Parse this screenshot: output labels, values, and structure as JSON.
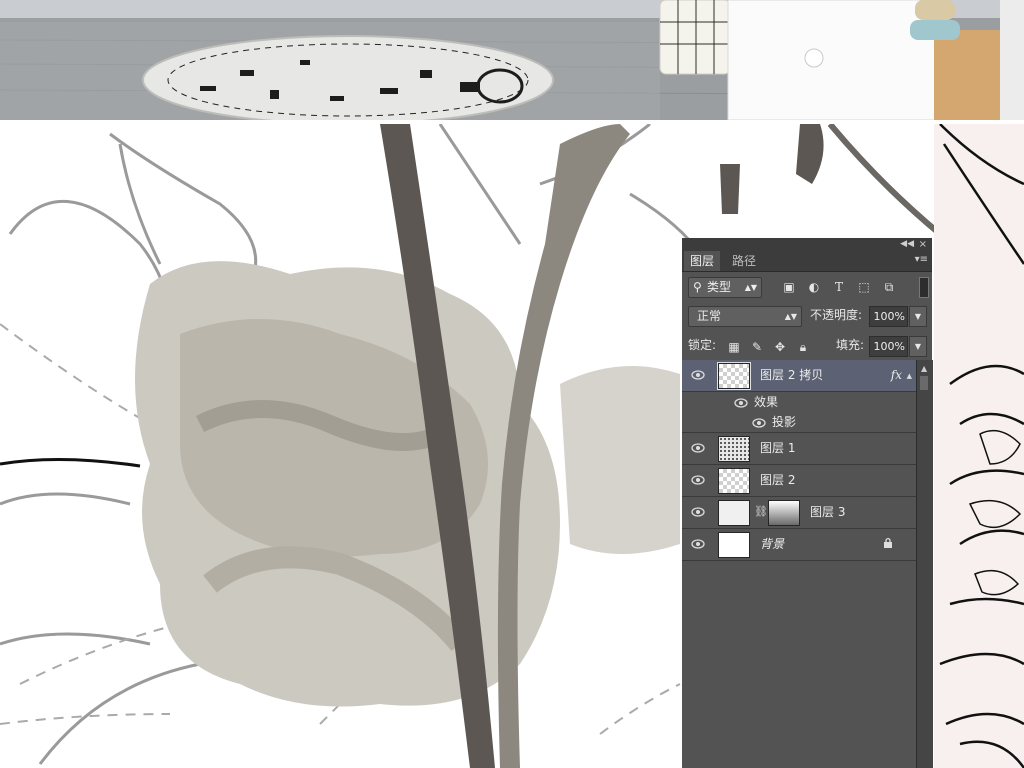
{
  "panel": {
    "collapse_icon": "double-arrow-icon",
    "close_label": "×",
    "tabs": [
      {
        "label": "图层"
      },
      {
        "label": "路径"
      }
    ],
    "menu_icon": "panel-menu-icon",
    "filter": {
      "kind_label": "类型",
      "icons": [
        "image-filter-icon",
        "adjustment-filter-icon",
        "type-filter-icon",
        "shape-filter-icon",
        "smartobject-filter-icon"
      ]
    },
    "blend_mode": "正常",
    "opacity_label": "不透明度:",
    "opacity_value": "100%",
    "lock_label": "锁定:",
    "lock_icons": [
      "lock-transparent-icon",
      "lock-image-icon",
      "lock-position-icon",
      "lock-all-icon"
    ],
    "fill_label": "填充:",
    "fill_value": "100%",
    "layers": [
      {
        "name": "图层 2 拷贝",
        "selected": true,
        "thumb": "checker",
        "fx": "fx",
        "effects_label": "效果",
        "effect_items": [
          "投影"
        ]
      },
      {
        "name": "图层 1",
        "selected": false,
        "thumb": "noise"
      },
      {
        "name": "图层 2",
        "selected": false,
        "thumb": "checker"
      },
      {
        "name": "图层 3",
        "selected": false,
        "thumb": "pale",
        "has_mask": true
      },
      {
        "name": "背景",
        "selected": false,
        "thumb": "white",
        "locked": true
      }
    ]
  }
}
